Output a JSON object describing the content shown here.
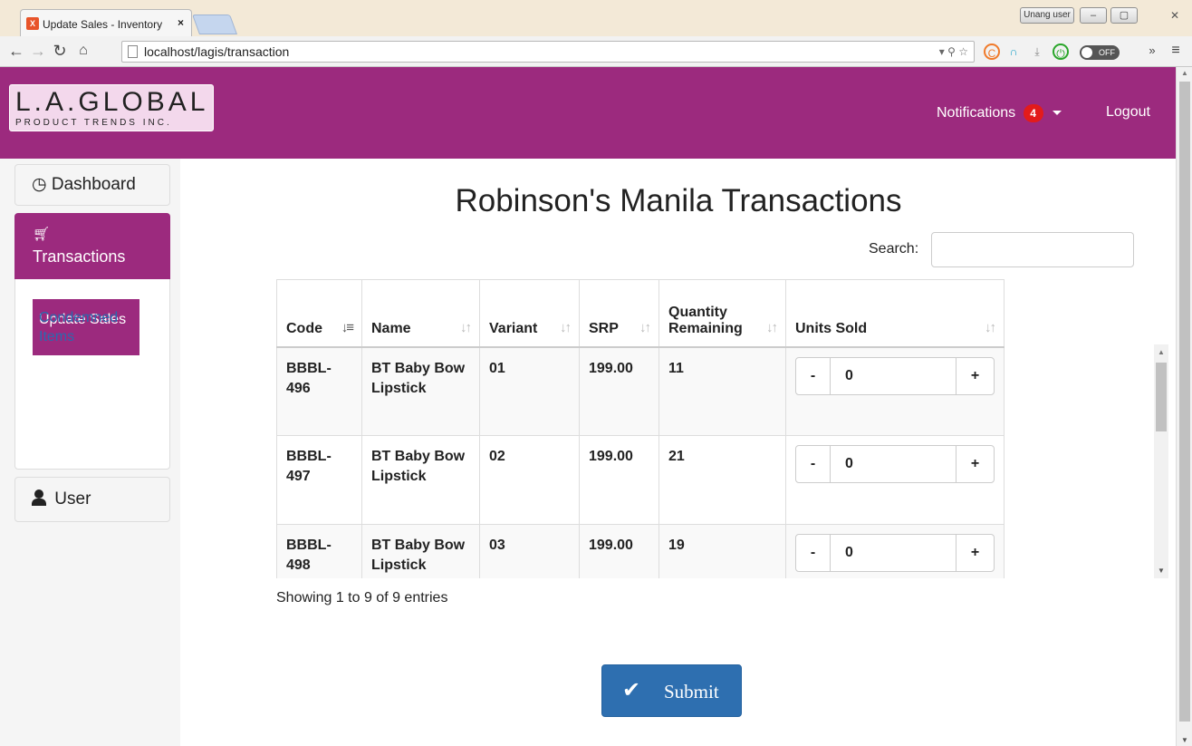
{
  "browser": {
    "tab_title": "Update Sales - Inventory",
    "tab_favicon": "X",
    "url": "localhost/lagis/transaction",
    "user_button": "Unang user",
    "toggle_label": "OFF"
  },
  "header": {
    "logo_main": "L.A.GLOBAL",
    "logo_sub": "PRODUCT TRENDS INC.",
    "notifications_label": "Notifications",
    "notifications_count": "4",
    "logout_label": "Logout",
    "color": "#9c2a7e"
  },
  "sidebar": {
    "dashboard_label": "Dashboard",
    "transactions_label": "Transactions",
    "sub_items": [
      {
        "label": "Update Sales",
        "active": true
      },
      {
        "label": "Condemned Items",
        "active": false
      }
    ],
    "user_label": "User"
  },
  "main": {
    "title": "Robinson's Manila Transactions",
    "search_label": "Search:",
    "search_value": "",
    "columns": [
      "Code",
      "Name",
      "Variant",
      "SRP",
      "Quantity Remaining",
      "Units Sold"
    ],
    "rows": [
      {
        "code": "BBBL-496",
        "name": "BT Baby Bow Lipstick",
        "variant": "01",
        "srp": "199.00",
        "qty": "11",
        "sold": "0"
      },
      {
        "code": "BBBL-497",
        "name": "BT Baby Bow Lipstick",
        "variant": "02",
        "srp": "199.00",
        "qty": "21",
        "sold": "0"
      },
      {
        "code": "BBBL-498",
        "name": "BT Baby Bow Lipstick",
        "variant": "03",
        "srp": "199.00",
        "qty": "19",
        "sold": "0"
      }
    ],
    "minus_label": "-",
    "plus_label": "+",
    "info": "Showing 1 to 9 of 9 entries",
    "submit_label": "Submit",
    "submit_color": "#2e6fb0"
  }
}
